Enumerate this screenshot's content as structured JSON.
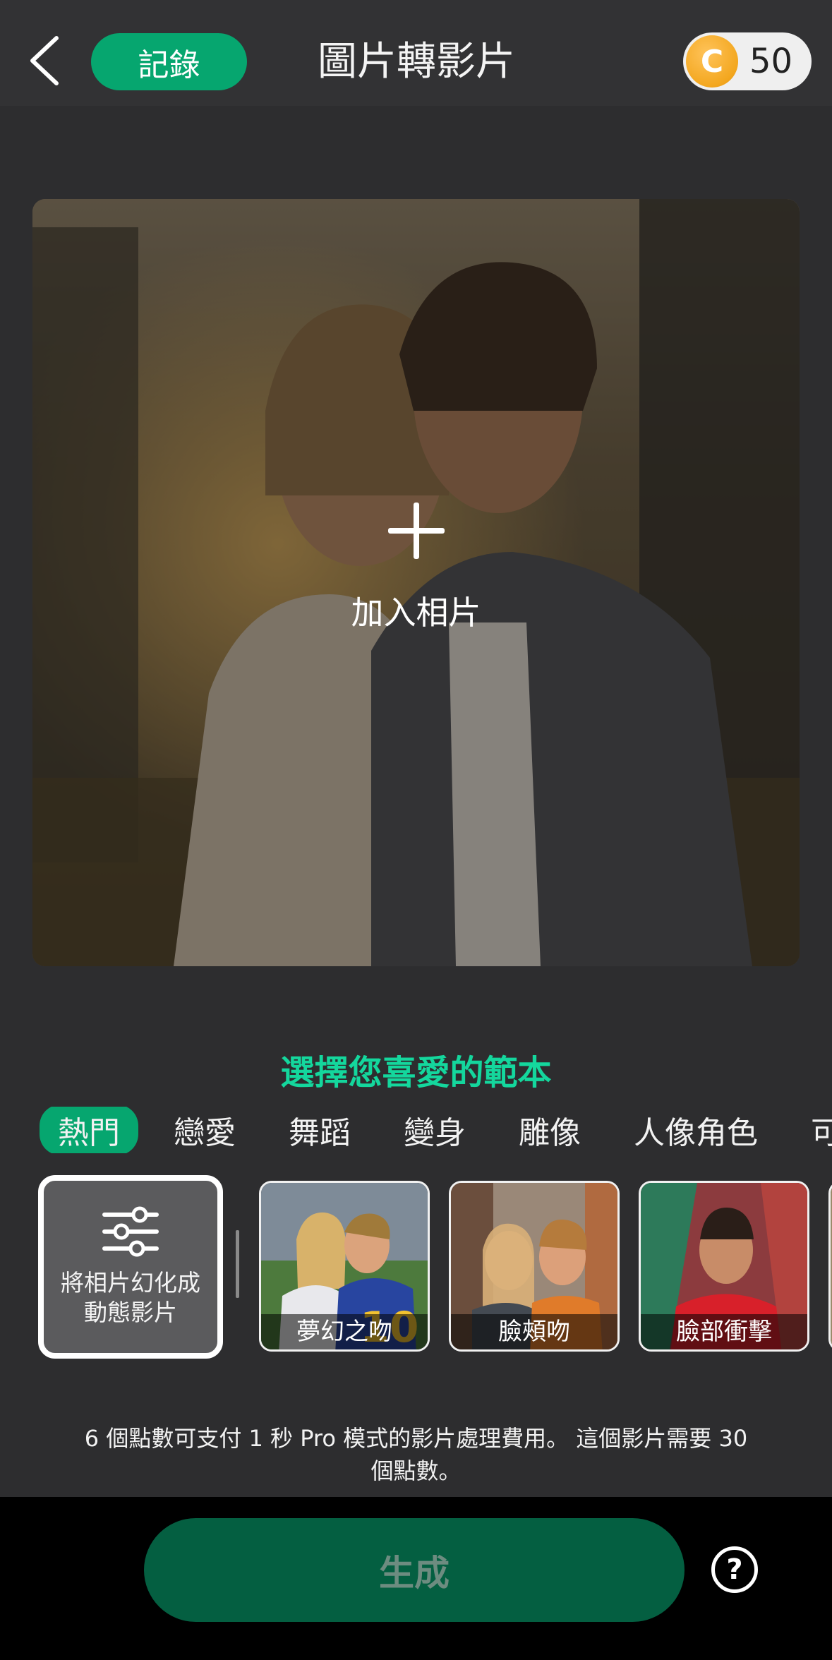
{
  "header": {
    "back_icon": "chevron-left-icon",
    "records_label": "記錄",
    "title": "圖片轉影片",
    "coin_symbol": "C",
    "coin_count": "50"
  },
  "upload": {
    "add_label": "加入相片",
    "icon": "plus-icon"
  },
  "templates": {
    "section_title": "選擇您喜愛的範本",
    "tabs": [
      "熱門",
      "戀愛",
      "舞蹈",
      "變身",
      "雕像",
      "人像角色",
      "可"
    ],
    "active_tab": "熱門",
    "custom_card_label_line1": "將相片幻化成",
    "custom_card_label_line2": "動態影片",
    "custom_card_icon": "sliders-icon",
    "items": [
      {
        "label": "夢幻之吻"
      },
      {
        "label": "臉頰吻"
      },
      {
        "label": "臉部衝擊"
      }
    ]
  },
  "info_text_line1": "6 個點數可支付 1 秒 Pro 模式的影片處理費用。 這個影片需要 30",
  "info_text_line2": "個點數。",
  "footer": {
    "generate_label": "生成",
    "help_symbol": "?"
  },
  "colors": {
    "accent": "#06a66f",
    "accent_text": "#14d79d",
    "generate_bg": "#045f41",
    "background": "#2d2d2f"
  }
}
